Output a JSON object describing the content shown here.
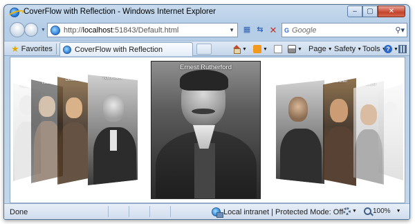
{
  "window": {
    "title": "CoverFlow with Reflection - Windows Internet Explorer",
    "caption_buttons": {
      "minimize": "–",
      "maximize": "▢",
      "close": "✕"
    }
  },
  "navigation": {
    "address_prefix": "http://",
    "address_host": "localhost",
    "address_rest": ":51843/Default.html",
    "search_placeholder": "Google",
    "search_engine_icon": "google-g"
  },
  "toolbar": {
    "favorites_label": "Favorites",
    "tab_label": "CoverFlow with Reflection",
    "page_label": "Page",
    "safety_label": "Safety",
    "tools_label": "Tools"
  },
  "coverflow": {
    "selected_caption": "Ernest Rutherford",
    "left_captions": [
      "Albert E",
      "Isaac",
      "Gottfried",
      "Niels Bohr"
    ],
    "right_captions": [
      "",
      "o Galilei",
      "n Giusti"
    ]
  },
  "status": {
    "text": "Done",
    "zone": "Local intranet | Protected Mode: Off",
    "zoom": "100%"
  },
  "colors": {
    "chrome": "#c3d7ec",
    "close_button": "#c4432c",
    "accent": "#2f62b5"
  }
}
